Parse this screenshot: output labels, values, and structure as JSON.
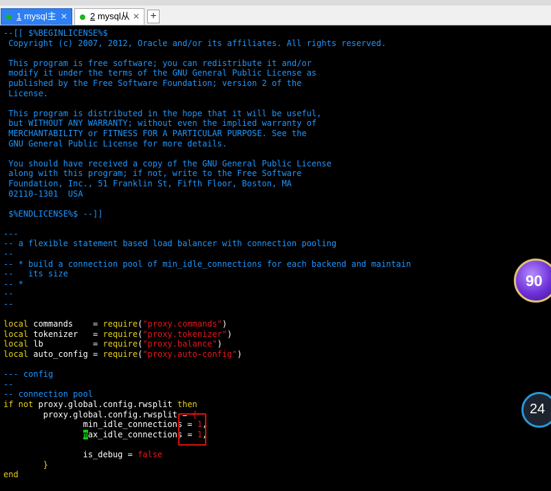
{
  "tabs": [
    {
      "number": "1",
      "label": " mysql主",
      "close": "✕"
    },
    {
      "number": "2",
      "label": " mysql从",
      "close": "✕"
    }
  ],
  "add_tab": "+",
  "code": {
    "l1": "--[[ $%BEGINLICENSE%$",
    "l2": " Copyright (c) 2007, 2012, Oracle and/or its affiliates. All rights reserved.",
    "l3": " This program is free software; you can redistribute it and/or",
    "l4": " modify it under the terms of the GNU General Public License as",
    "l5": " published by the Free Software Foundation; version 2 of the",
    "l6": " License.",
    "l7": " This program is distributed in the hope that it will be useful,",
    "l8": " but WITHOUT ANY WARRANTY; without even the implied warranty of",
    "l9": " MERCHANTABILITY or FITNESS FOR A PARTICULAR PURPOSE. See the",
    "l10": " GNU General Public License for more details.",
    "l11": " You should have received a copy of the GNU General Public License",
    "l12": " along with this program; if not, write to the Free Software",
    "l13": " Foundation, Inc., 51 Franklin St, Fifth Floor, Boston, MA",
    "l14": " 02110-1301  USA",
    "l15": " $%ENDLICENSE%$ --]]",
    "c1": "---",
    "c2": "-- a flexible statement based load balancer with connection pooling",
    "c3": "--",
    "c4": "-- * build a connection pool of min_idle_connections for each backend and maintain",
    "c5": "--   its size",
    "c6": "-- *",
    "c7": "--",
    "c8": "--",
    "local_kw": "local",
    "var_commands": " commands    = ",
    "var_tokenizer": " tokenizer   = ",
    "var_lb": " lb          = ",
    "var_auto": " auto_config = ",
    "require_kw": "require",
    "paren_open": "(",
    "paren_close": ")",
    "str_commands": "\"proxy.commands\"",
    "str_tokenizer": "\"proxy.tokenizer\"",
    "str_balance": "\"proxy.balance\"",
    "str_auto": "\"proxy.auto-config\"",
    "c9": "--- config",
    "c10": "--",
    "c11": "-- connection pool",
    "if_kw": "if",
    "not_kw": " not",
    "if_rest": " proxy.global.config.rwsplit ",
    "then_kw": "then",
    "assign_line": "        proxy.global.config.rwsplit = ",
    "brace_open": "{",
    "min_idle": "                min_idle_connections = ",
    "cursor_char": "m",
    "max_idle_rest": "ax_idle_connections = ",
    "indent16": "                ",
    "val_one": "1",
    "comma": ",",
    "is_debug": "                is_debug = ",
    "false_kw": "false",
    "brace_close": "        }",
    "end_kw": "end"
  },
  "widgets": {
    "score_badge": "90",
    "percent_badge": "24"
  },
  "colors": {
    "comment": "#1e96ff",
    "string": "#e8151a",
    "keyword": "#e8d21a",
    "cursor": "#0dd00d",
    "highlight_box": "#e01010",
    "active_tab": "#2d7ff3"
  }
}
